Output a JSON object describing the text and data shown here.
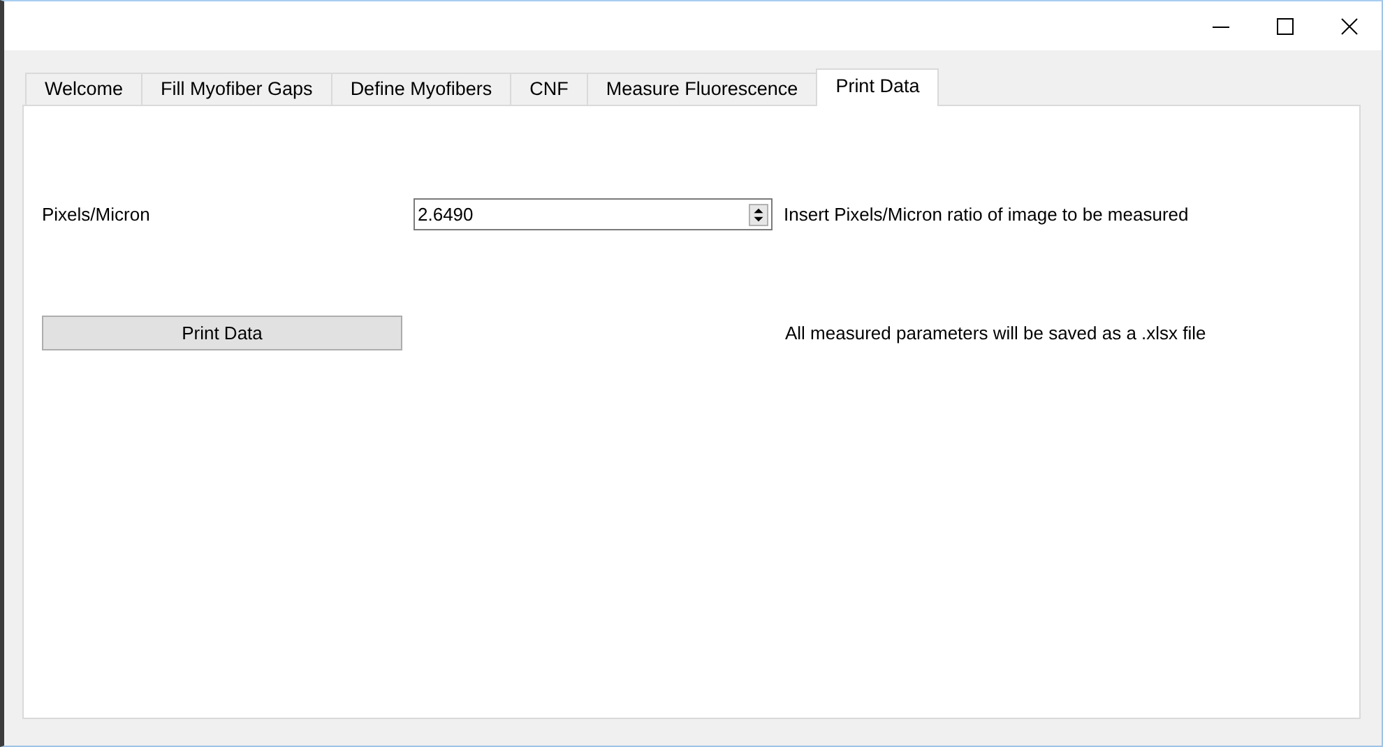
{
  "tabs": [
    {
      "label": "Welcome",
      "selected": false
    },
    {
      "label": "Fill Myofiber Gaps",
      "selected": false
    },
    {
      "label": "Define Myofibers",
      "selected": false
    },
    {
      "label": "CNF",
      "selected": false
    },
    {
      "label": "Measure Fluorescence",
      "selected": false
    },
    {
      "label": "Print Data",
      "selected": true
    }
  ],
  "pixels_per_micron": {
    "label": "Pixels/Micron",
    "value": "2.6490",
    "hint": "Insert Pixels/Micron ratio of image to be measured"
  },
  "print_button": {
    "label": "Print Data"
  },
  "note": "All measured parameters will be saved as a .xlsx file"
}
